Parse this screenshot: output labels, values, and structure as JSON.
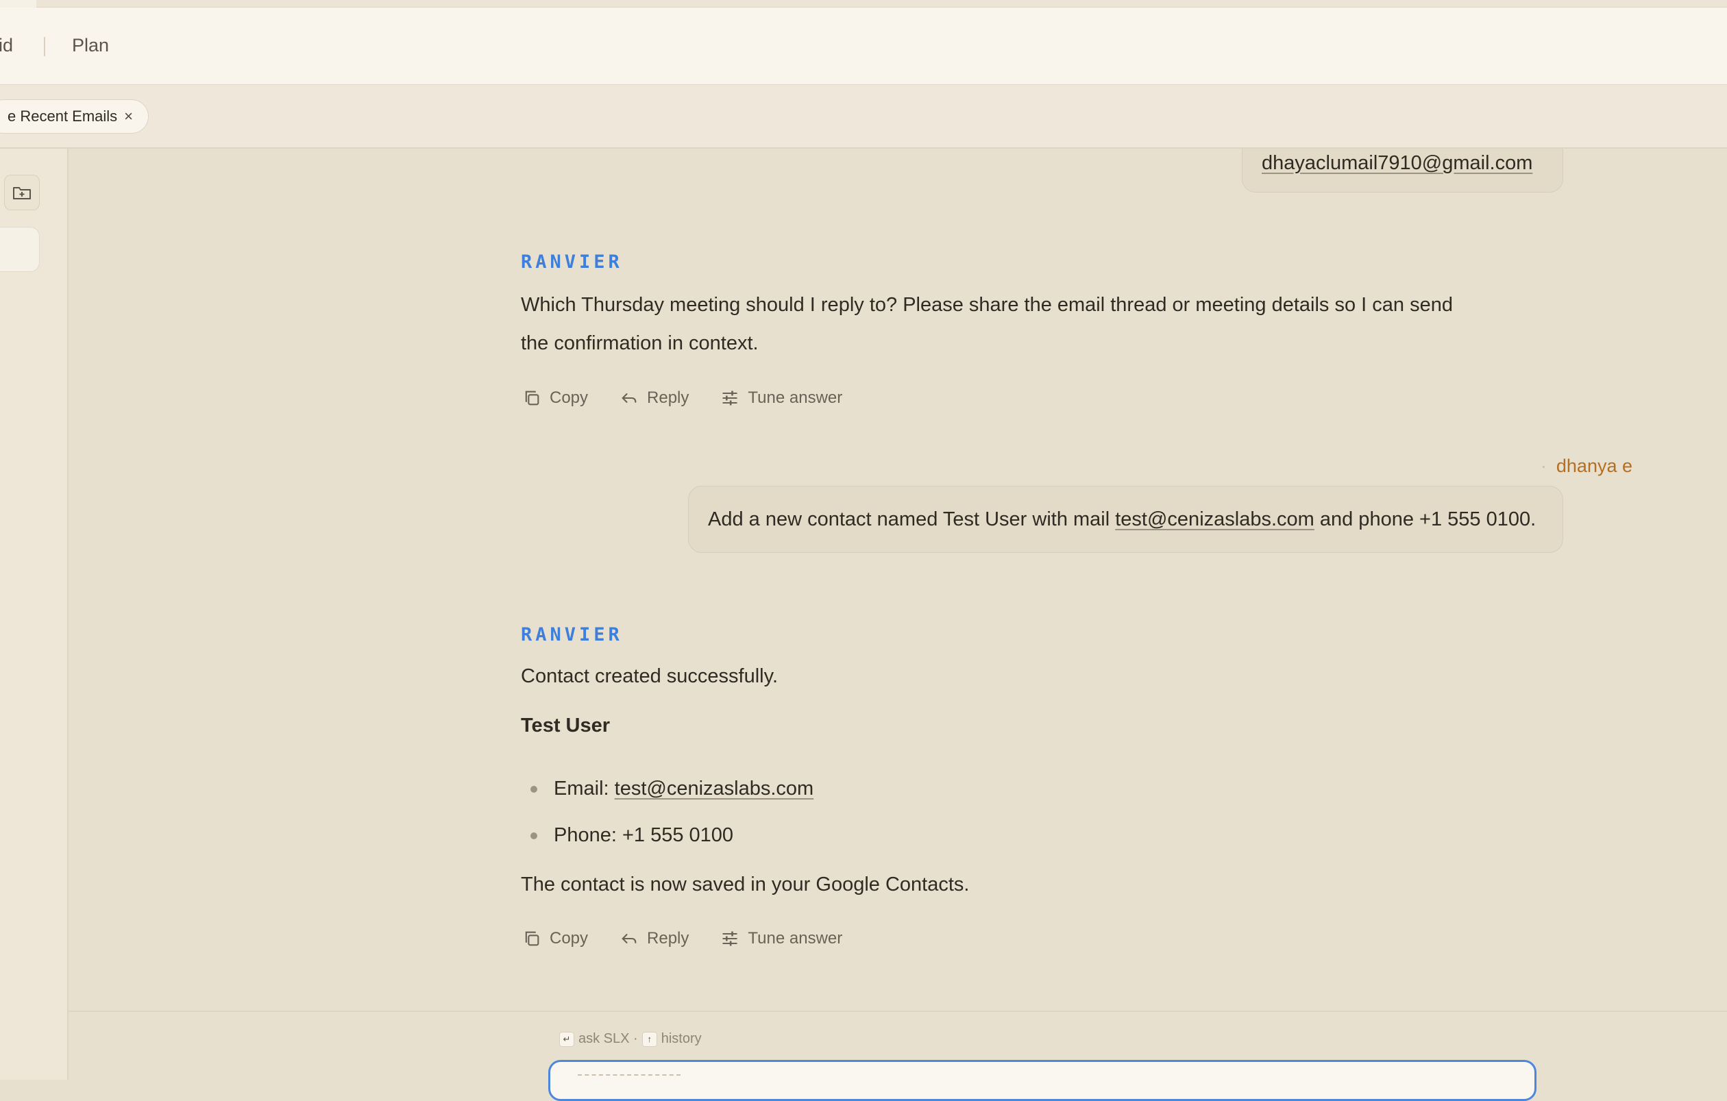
{
  "header": {
    "nav": [
      "id",
      "Plan"
    ]
  },
  "chip": {
    "label": "e Recent Emails",
    "close": "×"
  },
  "conversation": {
    "previous_user_email": "dhayaclumail7910@gmail.com",
    "assistant_1": {
      "sender": "RANVIER",
      "line1": "Which Thursday meeting should I reply to? Please share the email thread or meeting details so I can send",
      "line2": "the confirmation in context."
    },
    "user_2": {
      "name": "dhanya e",
      "text_before": "Add a new contact named Test User with mail ",
      "email": "test@cenizaslabs.com",
      "text_after": " and phone +1 555 0100."
    },
    "assistant_2": {
      "sender": "RANVIER",
      "intro": "Contact created successfully.",
      "contact_name": "Test User",
      "email_label": "Email: ",
      "email": "test@cenizaslabs.com",
      "phone": "Phone: +1 555 0100",
      "closing": "The contact is now saved in your Google Contacts."
    }
  },
  "actions": {
    "copy": "Copy",
    "reply": "Reply",
    "tune": "Tune answer"
  },
  "footer": {
    "enter_key": "↵",
    "ask": "ask SLX ·",
    "up_key": "↑",
    "history": "history"
  },
  "colors": {
    "accent_blue": "#3f7fdc",
    "user_orange": "#b36f22",
    "background": "#e8e0cf"
  }
}
